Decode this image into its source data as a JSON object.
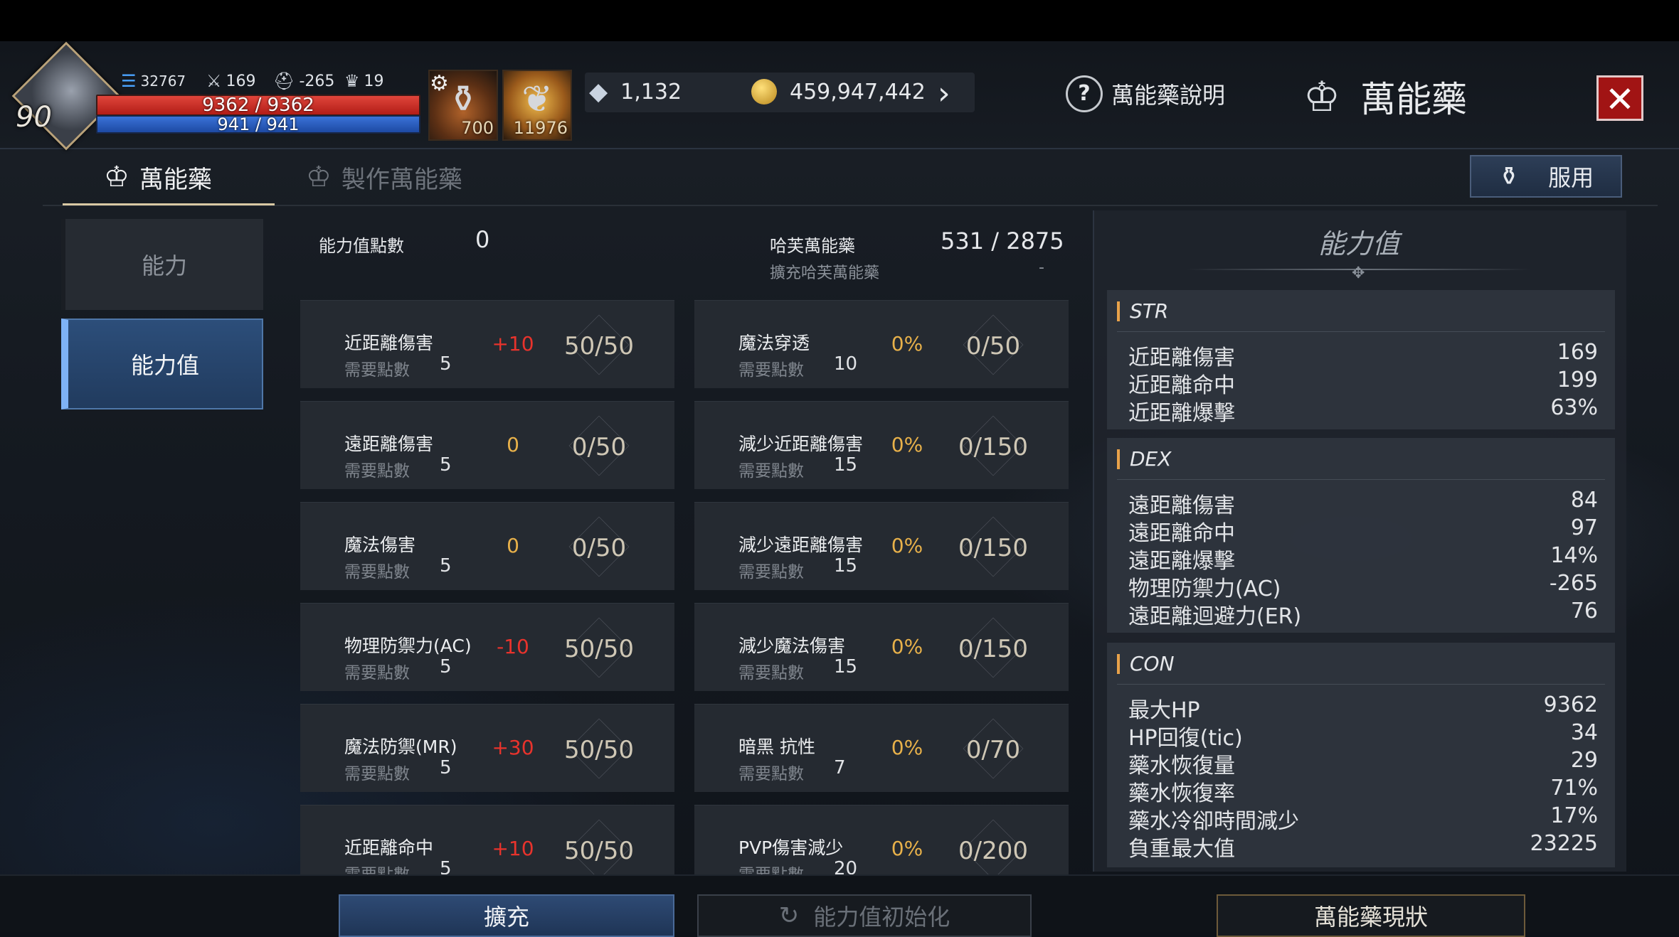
{
  "hud": {
    "level": "90",
    "power": "32767",
    "attack": "169",
    "defense": "-265",
    "trophy": "19",
    "hp": "9362 / 9362",
    "mp": "941 / 941",
    "slot1_count": "700",
    "slot2_count": "11976",
    "crystals": "1,132",
    "gold": "459,947,442",
    "help_label": "萬能藥說明",
    "title": "萬能藥"
  },
  "tabs": {
    "active": "萬能藥",
    "inactive": "製作萬能藥",
    "use_button": "服用"
  },
  "sidebar": {
    "items": [
      {
        "label": "能力"
      },
      {
        "label": "能力值"
      }
    ]
  },
  "header": {
    "points_label": "能力值點數",
    "points_value": "0",
    "elixir_label": "哈芙萬能藥",
    "elixir_value": "531 / 2875",
    "expand_label": "擴充哈芙萬能藥",
    "expand_value": "-"
  },
  "left_cards": [
    {
      "name": "近距離傷害",
      "req_label": "需要點數",
      "req": "5",
      "bonus": "+10",
      "progress": "50/50"
    },
    {
      "name": "遠距離傷害",
      "req_label": "需要點數",
      "req": "5",
      "bonus": "0",
      "progress": "0/50"
    },
    {
      "name": "魔法傷害",
      "req_label": "需要點數",
      "req": "5",
      "bonus": "0",
      "progress": "0/50"
    },
    {
      "name": "物理防禦力(AC)",
      "req_label": "需要點數",
      "req": "5",
      "bonus": "-10",
      "progress": "50/50"
    },
    {
      "name": "魔法防禦(MR)",
      "req_label": "需要點數",
      "req": "5",
      "bonus": "+30",
      "progress": "50/50"
    },
    {
      "name": "近距離命中",
      "req_label": "需要點數",
      "req": "5",
      "bonus": "+10",
      "progress": "50/50"
    }
  ],
  "right_cards": [
    {
      "name": "魔法穿透",
      "req_label": "需要點數",
      "req": "10",
      "bonus": "0%",
      "progress": "0/50"
    },
    {
      "name": "減少近距離傷害",
      "req_label": "需要點數",
      "req": "15",
      "bonus": "0%",
      "progress": "0/150"
    },
    {
      "name": "減少遠距離傷害",
      "req_label": "需要點數",
      "req": "15",
      "bonus": "0%",
      "progress": "0/150"
    },
    {
      "name": "減少魔法傷害",
      "req_label": "需要點數",
      "req": "15",
      "bonus": "0%",
      "progress": "0/150"
    },
    {
      "name": "暗黑 抗性",
      "req_label": "需要點數",
      "req": "7",
      "bonus": "0%",
      "progress": "0/70"
    },
    {
      "name": "PVP傷害減少",
      "req_label": "需要點數",
      "req": "20",
      "bonus": "0%",
      "progress": "0/200"
    }
  ],
  "stats_panel": {
    "title": "能力值",
    "groups": [
      {
        "name": "STR",
        "rows": [
          {
            "label": "近距離傷害",
            "value": "169"
          },
          {
            "label": "近距離命中",
            "value": "199"
          },
          {
            "label": "近距離爆擊",
            "value": "63%"
          }
        ]
      },
      {
        "name": "DEX",
        "rows": [
          {
            "label": "遠距離傷害",
            "value": "84"
          },
          {
            "label": "遠距離命中",
            "value": "97"
          },
          {
            "label": "遠距離爆擊",
            "value": "14%"
          },
          {
            "label": "物理防禦力(AC)",
            "value": "-265"
          },
          {
            "label": "遠距離迴避力(ER)",
            "value": "76"
          }
        ]
      },
      {
        "name": "CON",
        "rows": [
          {
            "label": "最大HP",
            "value": "9362"
          },
          {
            "label": "HP回復(tic)",
            "value": "34"
          },
          {
            "label": "藥水恢復量",
            "value": "29"
          },
          {
            "label": "藥水恢復率",
            "value": "71%"
          },
          {
            "label": "藥水冷卻時間減少",
            "value": "17%"
          },
          {
            "label": "負重最大值",
            "value": "23225"
          }
        ]
      }
    ]
  },
  "bottom": {
    "expand_button": "擴充",
    "reset_button": "能力值初始化",
    "status_button": "萬能藥現狀"
  },
  "colors": {
    "positive": "#e8332c",
    "neutral": "#e8b14a",
    "accent_blue": "#7eb2f5",
    "close_red": "#a11414"
  },
  "icons": [
    "search-none",
    "gear-icon",
    "question-icon",
    "elixir-icon",
    "close-icon",
    "chevron-right-icon",
    "potion-icon",
    "reset-icon"
  ]
}
